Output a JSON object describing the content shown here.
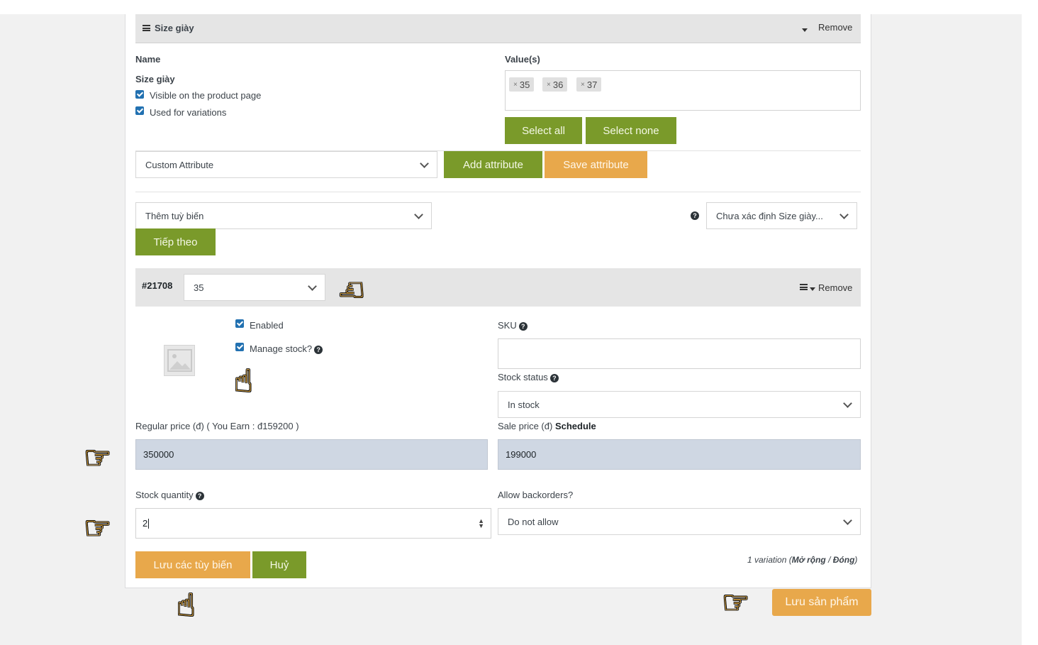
{
  "attribute": {
    "header_title": "Size giày",
    "remove_label": "Remove",
    "name_label": "Name",
    "name_value": "Size giày",
    "visible_label": "Visible on the product page",
    "variations_label": "Used for variations",
    "values_label": "Value(s)",
    "values": [
      "35",
      "36",
      "37"
    ],
    "select_all": "Select all",
    "select_none": "Select none"
  },
  "attribute_toolbar": {
    "custom_attribute": "Custom Attribute",
    "add_attribute": "Add attribute",
    "save_attribute": "Save attribute"
  },
  "variations_toolbar": {
    "bulk_action": "Thêm tuỳ biến",
    "next_button": "Tiếp theo",
    "default_select": "Chưa xác định Size giày..."
  },
  "variation": {
    "id": "#21708",
    "size_value": "35",
    "remove_label": "Remove",
    "enabled_label": "Enabled",
    "manage_stock_label": "Manage stock?",
    "sku_label": "SKU",
    "sku_value": "",
    "stock_status_label": "Stock status",
    "stock_status_value": "In stock",
    "regular_price_label": "Regular price (đ) ( You Earn : đ159200 )",
    "regular_price_value": "350000",
    "sale_price_label": "Sale price (đ)",
    "schedule_link": "Schedule",
    "sale_price_value": "199000",
    "stock_qty_label": "Stock quantity",
    "stock_qty_value": "2",
    "backorders_label": "Allow backorders?",
    "backorders_value": "Do not allow"
  },
  "footer": {
    "save_variations": "Lưu các tùy biến",
    "cancel": "Huỷ",
    "count_text": "1 variation (",
    "expand": "Mở rộng",
    "separator": " / ",
    "collapse": "Đóng",
    "close_paren": ")",
    "save_product": "Lưu sản phẩm"
  },
  "icons": {
    "hamburger": "menu-icon",
    "caret": "caret-down-icon",
    "help": "help-icon",
    "image_placeholder": "image-placeholder-icon",
    "pointer": "pointing-hand-icon"
  },
  "colors": {
    "green_button": "#7a9a2a",
    "orange_button": "#e8a84b",
    "checkbox": "#2271b1",
    "filled_input": "#cfd7e3"
  }
}
